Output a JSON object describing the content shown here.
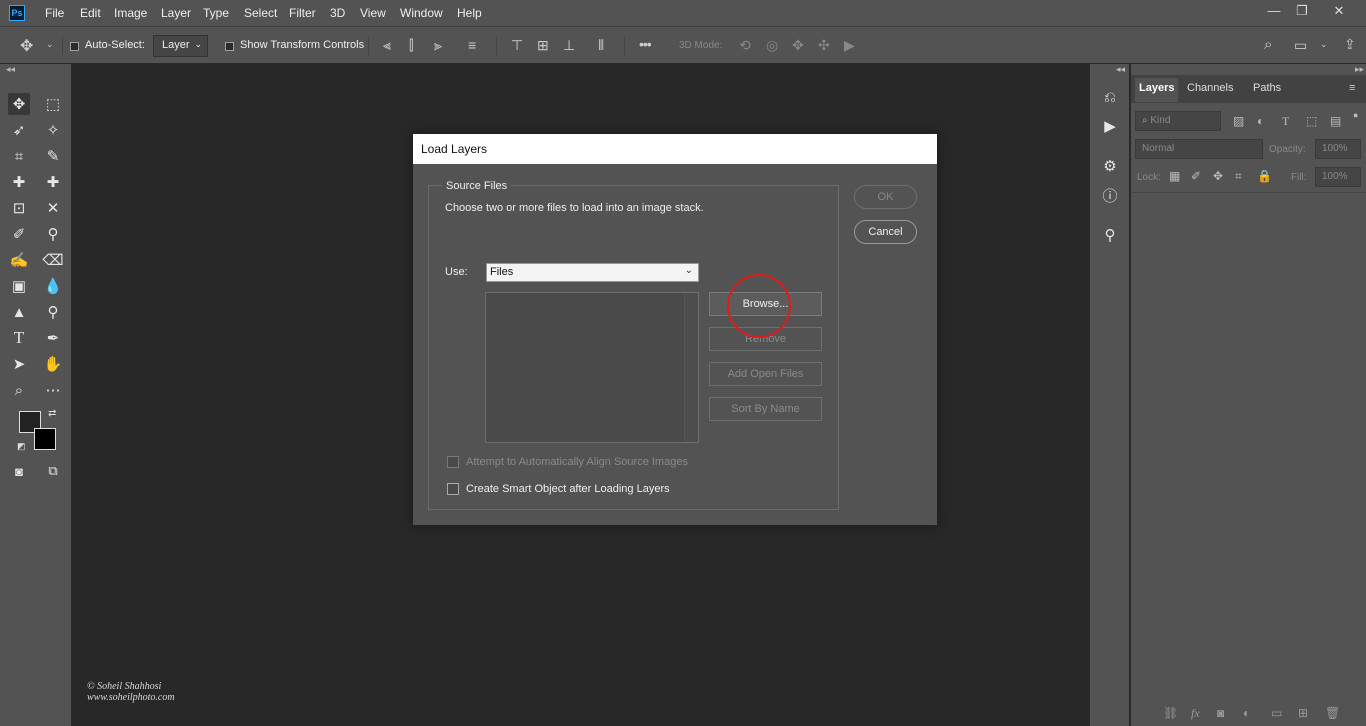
{
  "app": {
    "logo_text": "Ps"
  },
  "menubar": {
    "items": [
      "File",
      "Edit",
      "Image",
      "Layer",
      "Type",
      "Select",
      "Filter",
      "3D",
      "View",
      "Window",
      "Help"
    ]
  },
  "window_controls": {
    "minimize": "—",
    "restore": "❐",
    "close": "✕"
  },
  "options_bar": {
    "auto_select_label": "Auto-Select:",
    "auto_select_value": "Layer",
    "show_transform_label": "Show Transform Controls",
    "mode_3d_label": "3D Mode:"
  },
  "layers_panel": {
    "tabs": [
      "Layers",
      "Channels",
      "Paths"
    ],
    "kind_placeholder": "Kind",
    "blend_mode": "Normal",
    "opacity_label": "Opacity:",
    "opacity_value": "100%",
    "lock_label": "Lock:",
    "fill_label": "Fill:",
    "fill_value": "100%"
  },
  "dialog": {
    "title": "Load Layers",
    "group_label": "Source Files",
    "instruction": "Choose two or more files to load into an image stack.",
    "use_label": "Use:",
    "use_value": "Files",
    "buttons": {
      "browse": "Browse...",
      "remove": "Remove",
      "add_open_files": "Add Open Files",
      "sort_by_name": "Sort By Name"
    },
    "ok": "OK",
    "cancel": "Cancel",
    "checkbox_align": "Attempt to Automatically Align Source Images",
    "checkbox_smart": "Create Smart Object after Loading Layers"
  },
  "watermark": {
    "line1": "© Soheil Shahhosi",
    "line2": "www.soheilphoto.com"
  },
  "colors": {
    "annotation": "#e01b1b",
    "ps_blue": "#31a8ff"
  }
}
